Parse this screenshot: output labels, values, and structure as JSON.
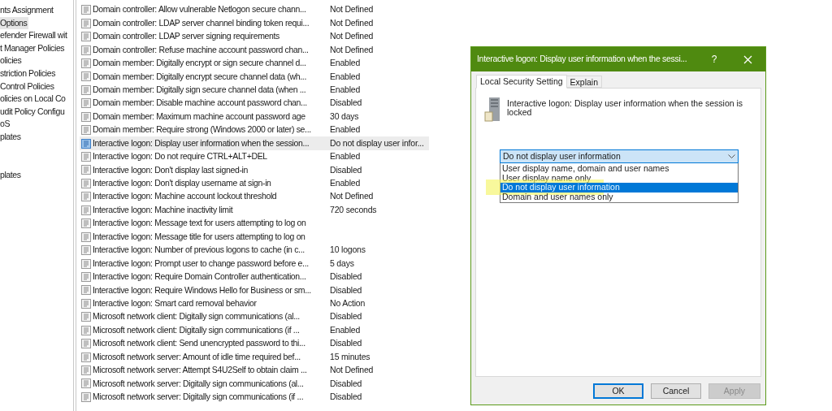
{
  "navigation_tree": {
    "items": [
      {
        "label": "nts Assignment",
        "selected": false
      },
      {
        "label": "Options",
        "selected": true
      },
      {
        "label": "efender Firewall wit",
        "selected": false
      },
      {
        "label": "t Manager Policies",
        "selected": false
      },
      {
        "label": "olicies",
        "selected": false
      },
      {
        "label": "striction Policies",
        "selected": false
      },
      {
        "label": "Control Policies",
        "selected": false
      },
      {
        "label": "olicies on Local Co",
        "selected": false
      },
      {
        "label": "udit Policy Configu",
        "selected": false
      },
      {
        "label": "oS",
        "selected": false
      },
      {
        "label": "plates",
        "selected": false
      }
    ],
    "lower_items": [
      {
        "label": "plates",
        "selected": false
      }
    ]
  },
  "policy_list": {
    "rows": [
      {
        "policy": "Domain controller: Allow vulnerable Netlogon secure chann...",
        "setting": "Not Defined",
        "selected": false
      },
      {
        "policy": "Domain controller: LDAP server channel binding token requi...",
        "setting": "Not Defined",
        "selected": false
      },
      {
        "policy": "Domain controller: LDAP server signing requirements",
        "setting": "Not Defined",
        "selected": false
      },
      {
        "policy": "Domain controller: Refuse machine account password chan...",
        "setting": "Not Defined",
        "selected": false
      },
      {
        "policy": "Domain member: Digitally encrypt or sign secure channel d...",
        "setting": "Enabled",
        "selected": false
      },
      {
        "policy": "Domain member: Digitally encrypt secure channel data (wh...",
        "setting": "Enabled",
        "selected": false
      },
      {
        "policy": "Domain member: Digitally sign secure channel data (when ...",
        "setting": "Enabled",
        "selected": false
      },
      {
        "policy": "Domain member: Disable machine account password chan...",
        "setting": "Disabled",
        "selected": false
      },
      {
        "policy": "Domain member: Maximum machine account password age",
        "setting": "30 days",
        "selected": false
      },
      {
        "policy": "Domain member: Require strong (Windows 2000 or later) se...",
        "setting": "Enabled",
        "selected": false
      },
      {
        "policy": "Interactive logon: Display user information when the session...",
        "setting": "Do not display user infor...",
        "selected": true
      },
      {
        "policy": "Interactive logon: Do not require CTRL+ALT+DEL",
        "setting": "Enabled",
        "selected": false
      },
      {
        "policy": "Interactive logon: Don't display last signed-in",
        "setting": "Disabled",
        "selected": false
      },
      {
        "policy": "Interactive logon: Don't display username at sign-in",
        "setting": "Enabled",
        "selected": false
      },
      {
        "policy": "Interactive logon: Machine account lockout threshold",
        "setting": "Not Defined",
        "selected": false
      },
      {
        "policy": "Interactive logon: Machine inactivity limit",
        "setting": "720 seconds",
        "selected": false
      },
      {
        "policy": "Interactive logon: Message text for users attempting to log on",
        "selected": false
      },
      {
        "policy": "Interactive logon: Message title for users attempting to log on",
        "selected": false
      },
      {
        "policy": "Interactive logon: Number of previous logons to cache (in c...",
        "setting": "10 logons",
        "selected": false
      },
      {
        "policy": "Interactive logon: Prompt user to change password before e...",
        "setting": "5 days",
        "selected": false
      },
      {
        "policy": "Interactive logon: Require Domain Controller authentication...",
        "setting": "Disabled",
        "selected": false
      },
      {
        "policy": "Interactive logon: Require Windows Hello for Business or sm...",
        "setting": "Disabled",
        "selected": false
      },
      {
        "policy": "Interactive logon: Smart card removal behavior",
        "setting": "No Action",
        "selected": false
      },
      {
        "policy": "Microsoft network client: Digitally sign communications (al...",
        "setting": "Disabled",
        "selected": false
      },
      {
        "policy": "Microsoft network client: Digitally sign communications (if ...",
        "setting": "Enabled",
        "selected": false
      },
      {
        "policy": "Microsoft network client: Send unencrypted password to thi...",
        "setting": "Disabled",
        "selected": false
      },
      {
        "policy": "Microsoft network server: Amount of idle time required bef...",
        "setting": "15 minutes",
        "selected": false
      },
      {
        "policy": "Microsoft network server: Attempt S4U2Self to obtain claim ...",
        "setting": "Not Defined",
        "selected": false
      },
      {
        "policy": "Microsoft network server: Digitally sign communications (al...",
        "setting": "Disabled",
        "selected": false
      },
      {
        "policy": "Microsoft network server: Digitally sign communications (if ...",
        "setting": "Disabled",
        "selected": false
      }
    ]
  },
  "dialog": {
    "title": "Interactive logon: Display user information when the sessi...",
    "help_button": "?",
    "tabs": [
      {
        "label": "Local Security Setting",
        "selected": true
      },
      {
        "label": "Explain",
        "selected": false
      }
    ],
    "description": "Interactive logon: Display user information when the session is locked",
    "dropdown": {
      "value": "Do not display user information",
      "expanded": true,
      "options": [
        {
          "label": "User display name, domain and user names",
          "selected": false,
          "highlighted": false
        },
        {
          "label": "User display name only",
          "selected": false,
          "highlighted": false
        },
        {
          "label": "Do not display user information",
          "selected": true,
          "highlighted": true
        },
        {
          "label": "Domain and user names only",
          "selected": false,
          "highlighted": false
        }
      ]
    },
    "buttons": [
      {
        "label": "OK",
        "kind": "default"
      },
      {
        "label": "Cancel",
        "kind": "normal"
      },
      {
        "label": "Apply",
        "kind": "disabled"
      }
    ]
  }
}
